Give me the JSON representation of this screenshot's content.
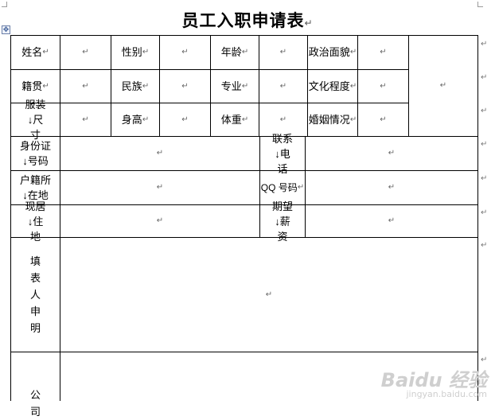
{
  "title": "员工入职申请表",
  "para_mark": "↵",
  "anchor_glyph": "✥",
  "rows": {
    "r1": {
      "name": "姓名",
      "gender": "性别",
      "age": "年龄",
      "politics": "政治面貌"
    },
    "r2": {
      "origin": "籍贯",
      "ethnicity": "民族",
      "major": "专业",
      "education": "文化程度"
    },
    "r3": {
      "clothing_size": "服装↓尺寸",
      "height": "身高",
      "weight": "体重",
      "marital": "婚姻情况"
    },
    "r4": {
      "id_number": "身份证↓号码",
      "phone": "联系↓电话"
    },
    "r5": {
      "hukou": "户籍所↓在地",
      "qq": "QQ 号码"
    },
    "r6": {
      "residence": "现居↓住地",
      "salary": "期望↓薪资"
    },
    "r7": {
      "declaration": "填表人申明"
    },
    "r8": {
      "company": "公司"
    }
  },
  "watermark": {
    "brand": "Baidu 经验",
    "url": "jingyan.baidu.com"
  }
}
